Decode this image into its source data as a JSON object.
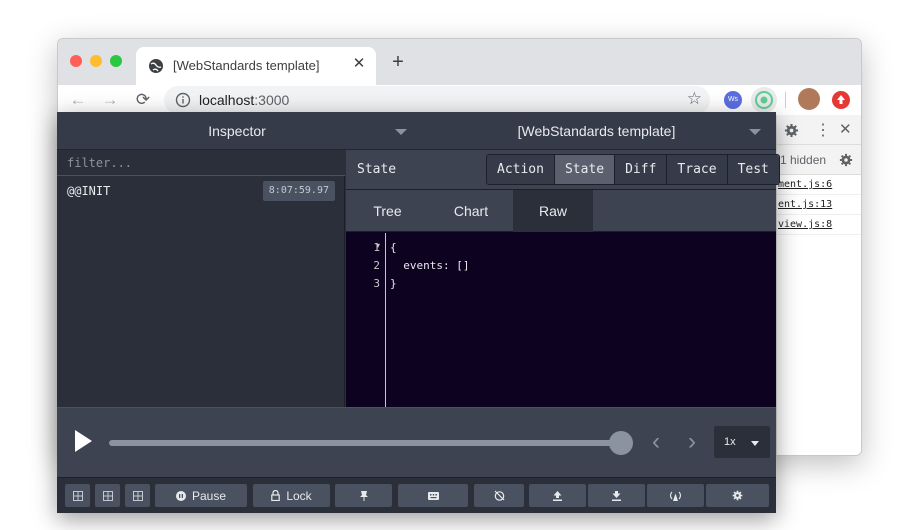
{
  "browser": {
    "tab_title": "[WebStandards template]",
    "tab_close": "✕",
    "new_tab": "+",
    "url_host": "localhost",
    "url_port": ":3000",
    "back": "←",
    "forward": "→",
    "reload": "⟳",
    "star": "☆",
    "ext_ws_label": "Ws"
  },
  "bg_devtools": {
    "hidden_label": "1 hidden",
    "links": [
      "ment.js:6",
      "ent.js:13",
      "view.js:8"
    ]
  },
  "redux": {
    "header": {
      "left_select": "Inspector",
      "right_select": "[WebStandards template]"
    },
    "filter_placeholder": "filter...",
    "actions": [
      {
        "name": "@@INIT",
        "time": "8:07:59.97"
      }
    ],
    "state_label": "State",
    "monitor_tabs": [
      "Action",
      "State",
      "Diff",
      "Trace",
      "Test"
    ],
    "active_monitor_tab": "State",
    "view_tabs": [
      "Tree",
      "Chart",
      "Raw"
    ],
    "active_view_tab": "Raw",
    "code_lines": [
      {
        "num": "1",
        "fold": "▾",
        "text": "{"
      },
      {
        "num": "2",
        "fold": "",
        "text": "  events: []"
      },
      {
        "num": "3",
        "fold": "",
        "text": "}"
      }
    ],
    "slider": {
      "progress": 1.0,
      "speed": "1x"
    },
    "footer": {
      "pause_label": "Pause",
      "lock_label": "Lock"
    }
  }
}
